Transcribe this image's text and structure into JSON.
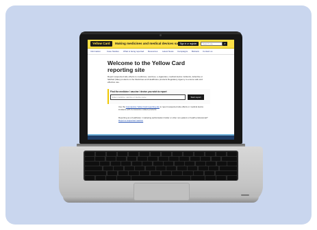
{
  "site": {
    "logo": "Yellow Card",
    "tagline": "Making medicines and medical devices safer",
    "signin": "Sign in or register",
    "search_placeholder": "Search site",
    "search_button": "⌕"
  },
  "nav": {
    "items": [
      "Information",
      "Case Studies",
      "What is being reported",
      "Resources",
      "Latest News",
      "Campaigns",
      "Biobank",
      "Contact us"
    ]
  },
  "hero": {
    "title": "Welcome to the Yellow Card reporting site",
    "text": "Report suspected side effects to medicines, vaccines, e-cigarettes, medical device incidents, defective or falsified (fake) products to the Medicines and Healthcare products Regulatory Agency to ensure safe and effective use."
  },
  "find": {
    "label": "Find the medicine / vaccine / device you wish to report",
    "placeholder": "Enter medicine, vaccine or device name",
    "button": "Start report"
  },
  "info": {
    "line1_prefix": "Use the ",
    "line1_link": "Coronavirus Yellow Card reporting site",
    "line1_suffix": " to report suspected side effects or medical device incidents with Coronavirus related products.",
    "line2_prefix": "Reporting as a healthcare / marketing authorisation holder or other non-patient or health professional? ",
    "line2_link": "Report a suspected reaction"
  }
}
